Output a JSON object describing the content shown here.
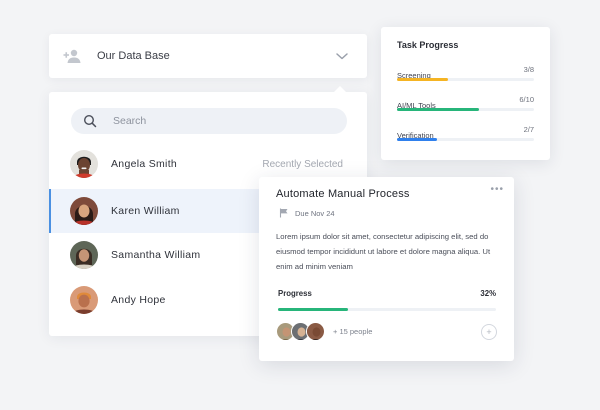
{
  "database": {
    "title": "Our Data Base"
  },
  "search": {
    "placeholder": "Search"
  },
  "people": [
    {
      "name": "Angela Smith",
      "tag": "Recently Selected"
    },
    {
      "name": "Karen William",
      "tag": ""
    },
    {
      "name": "Samantha William",
      "tag": ""
    },
    {
      "name": "Andy Hope",
      "tag": ""
    }
  ],
  "task_progress": {
    "title": "Task Progress",
    "items": [
      {
        "label": "Screening",
        "count": "3/8",
        "fraction": 0.375,
        "color": "#f5b423"
      },
      {
        "label": "AI/ML Tools",
        "count": "6/10",
        "fraction": 0.6,
        "color": "#27b57a"
      },
      {
        "label": "Verification",
        "count": "2/7",
        "fraction": 0.29,
        "color": "#2f80ed"
      }
    ]
  },
  "task": {
    "title": "Automate Manual Process",
    "more": "•••",
    "due": "Due Nov 24",
    "description": "Lorem ipsum dolor sit amet, consectetur adipiscing elit, sed do eiusmod tempor incididunt ut labore et dolore magna aliqua. Ut enim ad minim veniam",
    "progress_label": "Progress",
    "progress_text": "32%",
    "progress_value": 0.32,
    "members_more": "+ 15 people",
    "add_symbol": "+"
  },
  "icons": {
    "add_user": "add-user-icon",
    "chevron": "chevron-down-icon",
    "search": "search-icon",
    "flag": "flag-icon"
  }
}
